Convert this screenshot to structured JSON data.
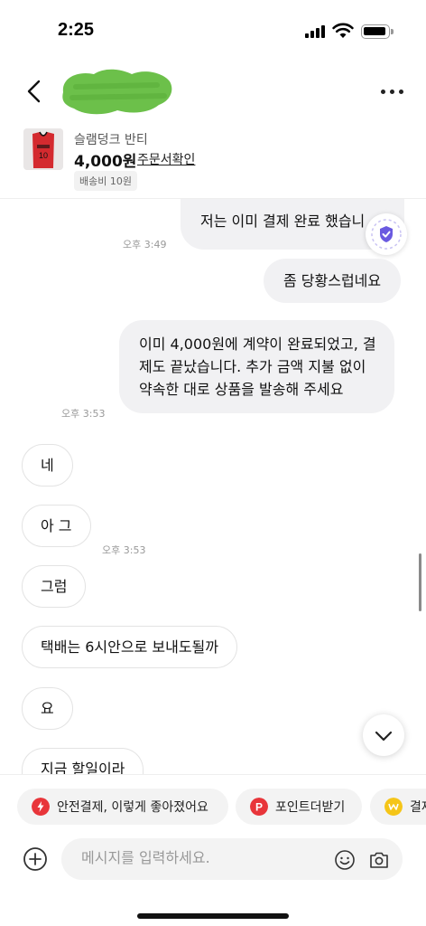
{
  "status": {
    "time": "2:25"
  },
  "product": {
    "name": "슬램덩크 반티",
    "price": "4,000원",
    "order_link": "주문서확인",
    "shipping": "배송비 10원"
  },
  "messages": {
    "m1": "저는 이미 결제 완료 했습니",
    "t1": "오후 3:49",
    "m2": "좀 당황스럽네요",
    "m3_line1": "이미 4,000원에 계약이 완료되었고, 결",
    "m3_line2": "제도 끝났습니다. 추가 금액 지불 없이",
    "m3_line3": "약속한 대로 상품을 발송해 주세요",
    "t2": "오후 3:53",
    "r1": "네",
    "r2": "아 그",
    "t3": "오후 3:53",
    "r3": "그럼",
    "r4": "택배는 6시안으로 보내도될까",
    "r5": "요",
    "r6": "지금 할일이라"
  },
  "quick_actions": [
    {
      "label": "안전결제, 이렇게 좋아졌어요",
      "icon": "lightning-icon",
      "color": "#e8353a"
    },
    {
      "label": "포인트더받기",
      "icon": "points-icon",
      "color": "#e8353a"
    },
    {
      "label": "결제",
      "icon": "won-icon",
      "color": "#f5c518"
    }
  ],
  "composer": {
    "placeholder": "메시지를 입력하세요."
  },
  "colors": {
    "bubble_mine": "#f1f1f3",
    "badge_purple": "#6a5ae0"
  }
}
